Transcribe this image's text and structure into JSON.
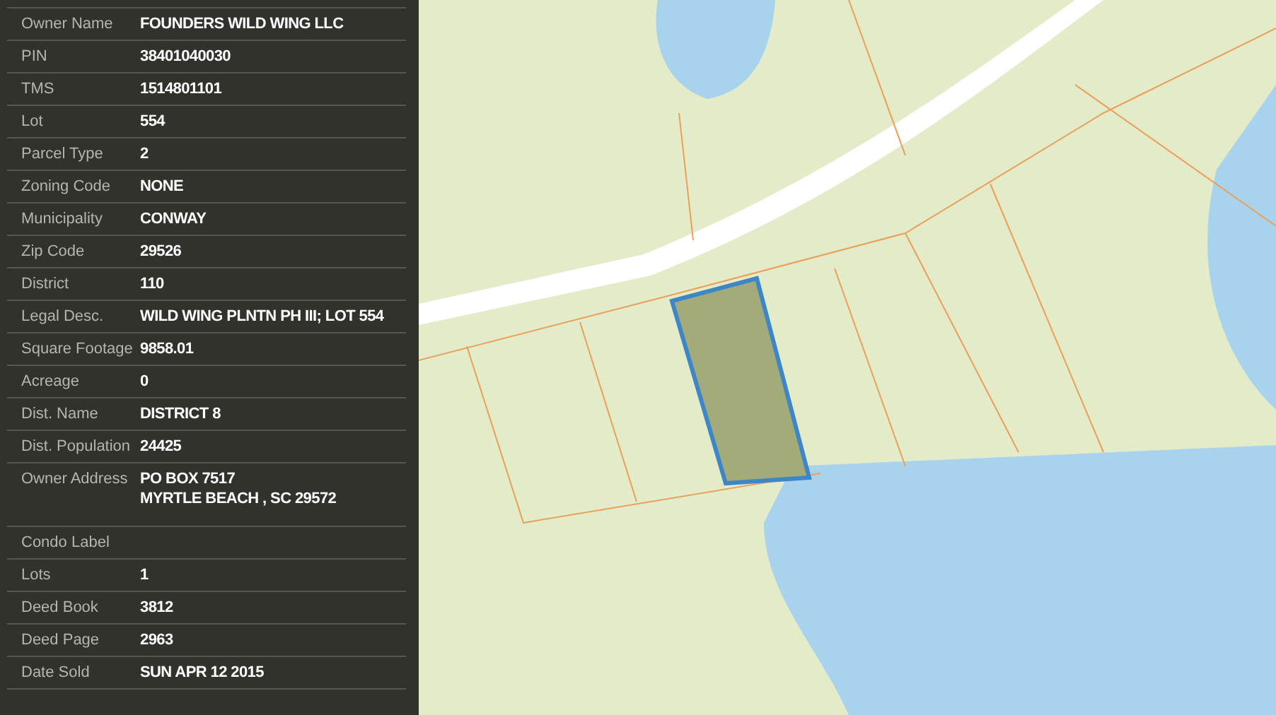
{
  "parcel_details": [
    {
      "label": "Owner Name",
      "value": [
        "FOUNDERS WILD WING LLC"
      ]
    },
    {
      "label": "PIN",
      "value": [
        "38401040030"
      ]
    },
    {
      "label": "TMS",
      "value": [
        "1514801101"
      ]
    },
    {
      "label": "Lot",
      "value": [
        "554"
      ]
    },
    {
      "label": "Parcel Type",
      "value": [
        "2"
      ]
    },
    {
      "label": "Zoning Code",
      "value": [
        "NONE"
      ]
    },
    {
      "label": "Municipality",
      "value": [
        "CONWAY"
      ]
    },
    {
      "label": "Zip Code",
      "value": [
        "29526"
      ]
    },
    {
      "label": "District",
      "value": [
        "110"
      ]
    },
    {
      "label": "Legal Desc.",
      "value": [
        "WILD WING PLNTN PH III; LOT 554"
      ]
    },
    {
      "label": "Square Footage",
      "value": [
        "9858.01"
      ]
    },
    {
      "label": "Acreage",
      "value": [
        "0"
      ]
    },
    {
      "label": "Dist. Name",
      "value": [
        "DISTRICT 8"
      ]
    },
    {
      "label": "Dist. Population",
      "value": [
        "24425"
      ]
    },
    {
      "label": "Owner Address",
      "value": [
        "PO BOX 7517",
        "MYRTLE BEACH , SC 29572"
      ]
    },
    {
      "label": "Condo Label"
    },
    {
      "label": "Lots",
      "value": [
        "1"
      ]
    },
    {
      "label": "Deed Book",
      "value": [
        "3812"
      ]
    },
    {
      "label": "Deed Page",
      "value": [
        "2963"
      ]
    },
    {
      "label": "Date Sold",
      "value": [
        "SUN APR 12 2015"
      ]
    }
  ]
}
